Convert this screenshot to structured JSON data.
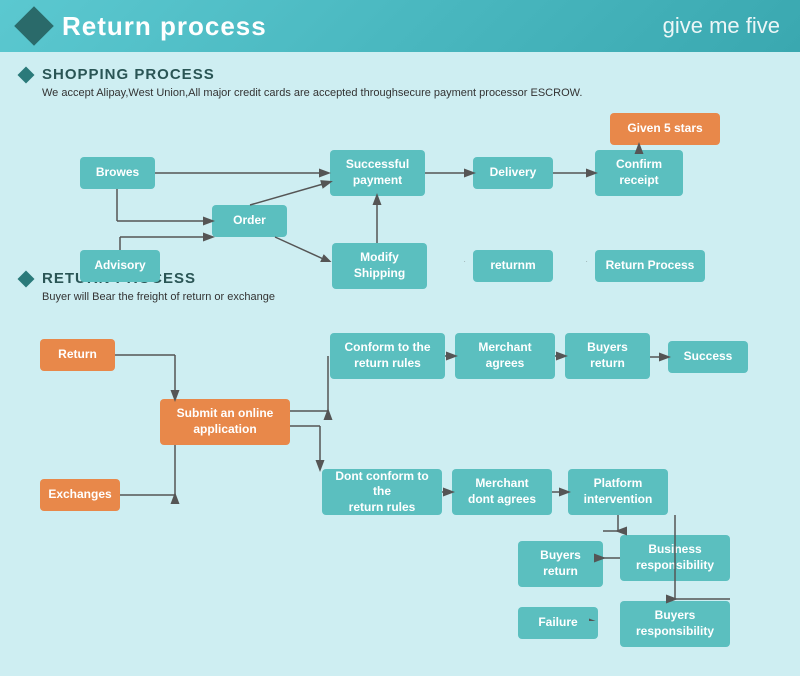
{
  "header": {
    "title": "Return process",
    "logo": "give me five",
    "diamond_label": "header-diamond"
  },
  "shopping_section": {
    "title": "SHOPPING PROCESS",
    "description": "We accept Alipay,West Union,All major credit cards are accepted throughsecure payment processor ESCROW.",
    "boxes": {
      "browes": "Browes",
      "order": "Order",
      "advisory": "Advisory",
      "modify_shipping": "Modify\nShipping",
      "successful_payment": "Successful\npayment",
      "delivery": "Delivery",
      "confirm_receipt": "Confirm\nreceipt",
      "given_5_stars": "Given 5 stars",
      "returnm": "returnm",
      "return_process": "Return Process"
    }
  },
  "return_section": {
    "title": "RETURN PROCESS",
    "description": "Buyer will Bear the freight of return or exchange",
    "boxes": {
      "return_btn": "Return",
      "exchanges": "Exchanges",
      "submit_online": "Submit an online\napplication",
      "conform_return_rules": "Conform to the\nreturn rules",
      "dont_conform_return_rules": "Dont conform to the\nreturn rules",
      "merchant_agrees": "Merchant\nagrees",
      "merchant_dont_agrees": "Merchant\ndont agrees",
      "buyers_return_1": "Buyers\nreturn",
      "buyers_return_2": "Buyers\nreturn",
      "success": "Success",
      "platform_intervention": "Platform\nintervention",
      "business_responsibility": "Business\nresponsibility",
      "buyers_responsibility": "Buyers\nresponsibility",
      "failure": "Failure"
    }
  }
}
